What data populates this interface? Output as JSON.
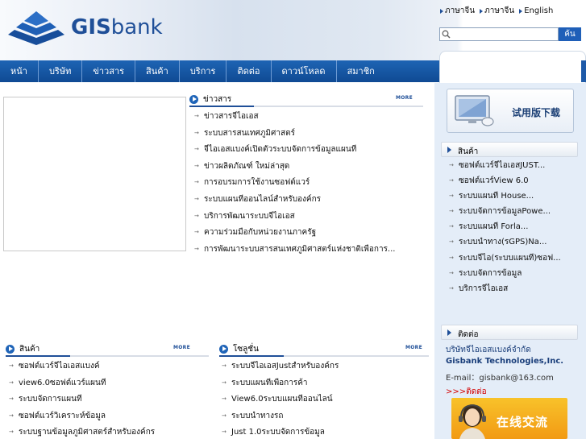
{
  "header": {
    "logo_text_bold": "GIS",
    "logo_text_light": "bank",
    "top_links": [
      "ภาษาจีน",
      "ภาษาจีน",
      "English"
    ],
    "search": {
      "placeholder": "",
      "button": "ค้น"
    }
  },
  "nav": {
    "items": [
      "หน้า",
      "บริษัท",
      "ข่าวสาร",
      "สินค้า",
      "บริการ",
      "ติดต่อ",
      "ดาวน์โหลด",
      "สมาชิก"
    ]
  },
  "news": {
    "title": "ข่าวสาร",
    "more": "MORE",
    "items": [
      "ข่าวสารจีไอเอส",
      "ระบบสารสนเทศภูมิศาสตร์",
      "จีไอเอสแบงค์เปิดตัวระบบจัดการข้อมูลแผนที่",
      "ข่าวผลิตภัณฑ์ ใหม่ล่าสุด",
      "การอบรมการใช้งานซอฟต์แวร์",
      "ระบบแผนที่ออนไลน์สำหรับองค์กร",
      "บริการพัฒนาระบบจีไอเอส",
      "ความร่วมมือกับหน่วยงานภาครัฐ",
      "การพัฒนาระบบสารสนเทศภูมิศาสตร์แห่งชาติเพื่อการ..."
    ]
  },
  "products": {
    "title": "สินค้า",
    "more": "MORE",
    "items": [
      "ซอฟต์แวร์จีไอเอสแบงค์",
      "view6.0ซอฟต์แวร์แผนที่",
      "ระบบจัดการแผนที่",
      "ซอฟต์แวร์วิเคราะห์ข้อมูล",
      "ระบบฐานข้อมูลภูมิศาสตร์สำหรับองค์กร"
    ]
  },
  "solutions": {
    "title": "โซลูชั่น",
    "more": "MORE",
    "items": [
      "ระบบจีไอเอสJustสำหรับองค์กร",
      "ระบบแผนที่เพื่อการค้า",
      "View6.0ระบบแผนที่ออนไลน์",
      "ระบบนำทางรถ",
      "Just 1.0ระบบจัดการข้อมูล"
    ]
  },
  "sidebar": {
    "trial_label": "试用版下载",
    "products_title": "สินค้า",
    "products": [
      "ซอฟต์แวร์จีไอเอสJUST...",
      "ซอฟต์แวร์View 6.0",
      "ระบบแผนที่ House...",
      "ระบบจัดการข้อมูลPowe...",
      "ระบบแผนที่ Forla...",
      "ระบบนำทาง(รGPS)Na...",
      "ระบบจีไอ(ระบบแผนที่)ซอฟ...",
      "ระบบจัดการข้อมูล",
      "บริการจีไอเอส"
    ],
    "contact_title": "ติดต่อ",
    "company": "บริษัทจีไอเอสแบงค์จำกัด",
    "company_en": "Gisbank Technologies,Inc.",
    "email": "E-mail：gisbank@163.com",
    "more_link": ">>>ติดต่อ",
    "chat_label": "在线交流"
  }
}
